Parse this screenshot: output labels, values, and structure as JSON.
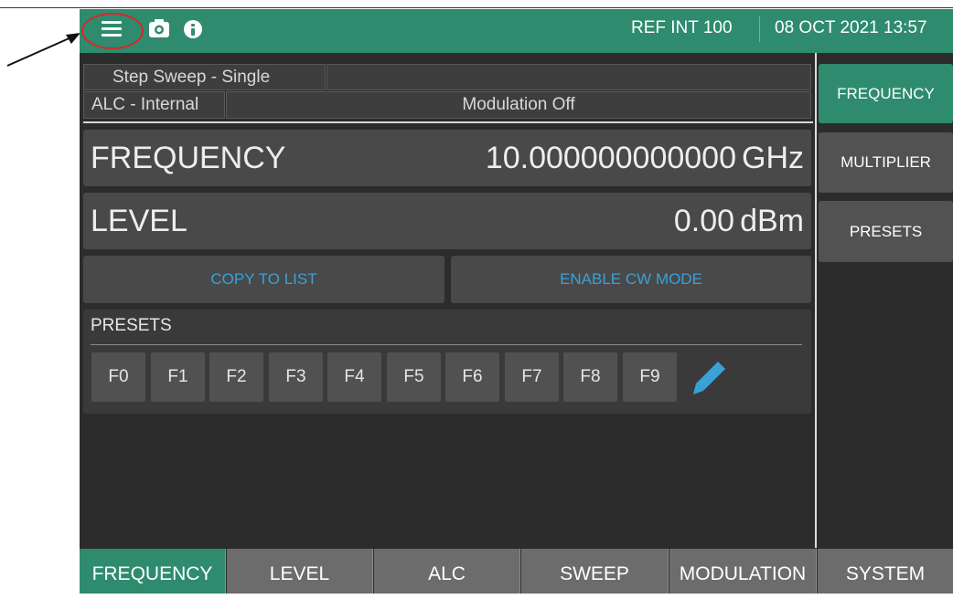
{
  "header": {
    "reference": "REF INT 100",
    "datetime": "08 OCT 2021 13:57",
    "accent_color": "#2e8b6e"
  },
  "icons": [
    "menu-icon",
    "camera-icon",
    "info-icon",
    "edit-pencil-icon"
  ],
  "status": {
    "sweep_mode": "Step Sweep - Single",
    "alc_mode": "ALC - Internal",
    "modulation": "Modulation Off"
  },
  "frequency": {
    "label": "FREQUENCY",
    "value": "10.000000000000",
    "unit": "GHz"
  },
  "level": {
    "label": "LEVEL",
    "value": "0.00",
    "unit": "dBm"
  },
  "actions": {
    "copy_to_list": "COPY TO LIST",
    "enable_cw": "ENABLE CW MODE"
  },
  "presets": {
    "title": "PRESETS",
    "keys": [
      "F0",
      "F1",
      "F2",
      "F3",
      "F4",
      "F5",
      "F6",
      "F7",
      "F8",
      "F9"
    ]
  },
  "sidebar": {
    "items": [
      {
        "label": "FREQUENCY",
        "active": true
      },
      {
        "label": "MULTIPLIER",
        "active": false
      },
      {
        "label": "PRESETS",
        "active": false
      }
    ]
  },
  "tabs": [
    {
      "label": "FREQUENCY",
      "active": true
    },
    {
      "label": "LEVEL",
      "active": false
    },
    {
      "label": "ALC",
      "active": false
    },
    {
      "label": "SWEEP",
      "active": false
    },
    {
      "label": "MODULATION",
      "active": false
    },
    {
      "label": "SYSTEM",
      "active": false
    }
  ]
}
